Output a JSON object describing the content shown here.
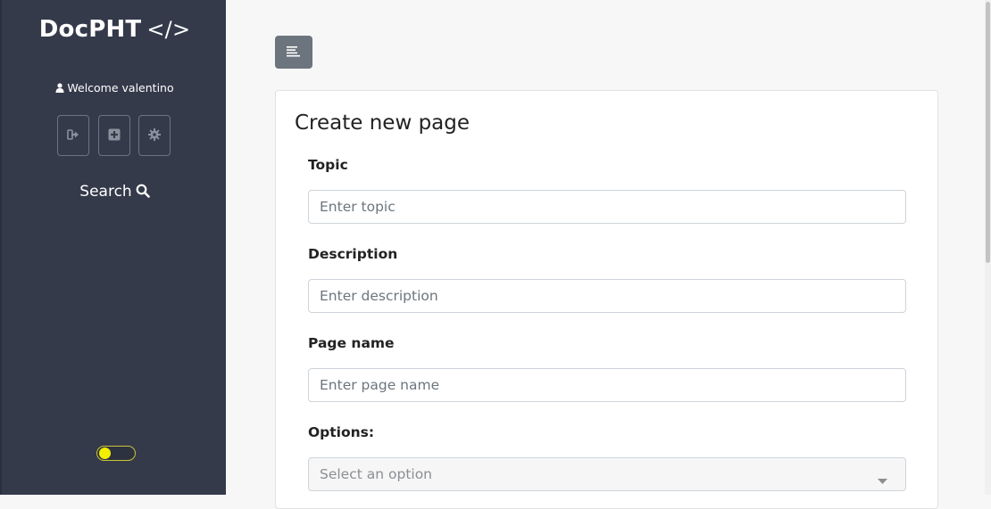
{
  "sidebar": {
    "brand": "DocPHT",
    "brand_code": "</>",
    "welcome": "Welcome valentino",
    "buttons": [
      {
        "icon": "logout-icon"
      },
      {
        "icon": "plus-square-icon"
      },
      {
        "icon": "gear-icon"
      }
    ],
    "search_label": "Search"
  },
  "form": {
    "title": "Create new page",
    "topic_label": "Topic",
    "topic_placeholder": "Enter topic",
    "description_label": "Description",
    "description_placeholder": "Enter description",
    "page_name_label": "Page name",
    "page_name_placeholder": "Enter page name",
    "options_label": "Options:",
    "options_selected": "Select an option"
  },
  "colors": {
    "sidebar_bg": "#343a4a",
    "toggle_knob": "#f2ef00",
    "menu_button": "#6c757d"
  }
}
